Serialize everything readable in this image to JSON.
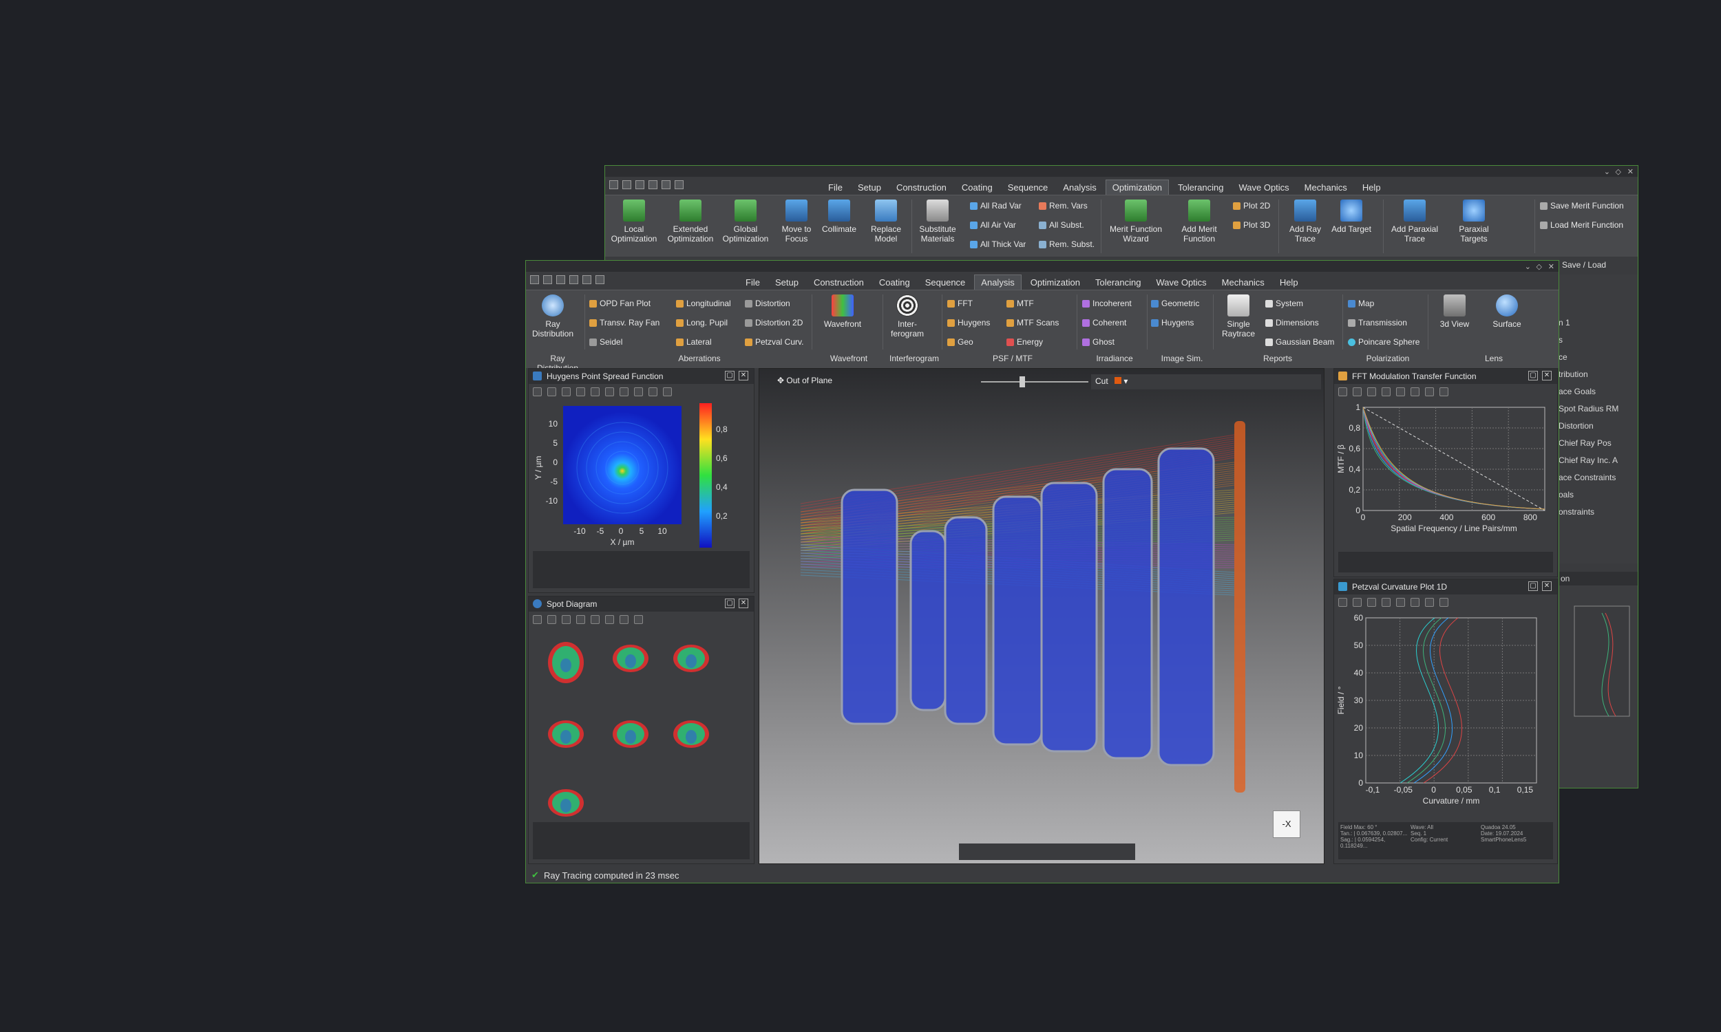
{
  "back_window": {
    "menu": [
      "File",
      "Setup",
      "Construction",
      "Coating",
      "Sequence",
      "Analysis",
      "Optimization",
      "Tolerancing",
      "Wave Optics",
      "Mechanics",
      "Help"
    ],
    "active_menu": "Optimization",
    "buttons": {
      "local_opt": "Local Optimization",
      "ext_opt": "Extended Optimization",
      "global_opt": "Global Optimization",
      "move_focus": "Move to Focus",
      "collimate": "Collimate",
      "replace": "Replace Model",
      "substitute": "Substitute Materials",
      "all_rad": "All Rad Var",
      "all_air": "All Air Var",
      "all_thick": "All Thick Var",
      "rem_vars": "Rem. Vars",
      "all_subst": "All Subst.",
      "rem_subst": "Rem. Subst.",
      "merit_wizard": "Merit Function Wizard",
      "add_merit": "Add Merit Function",
      "plot2d": "Plot 2D",
      "plot3d": "Plot 3D",
      "add_ray": "Add Ray Trace",
      "add_target": "Add Target",
      "add_paraxial": "Add Paraxial Trace",
      "paraxial_targets": "Paraxial Targets",
      "save_merit": "Save Merit Function",
      "load_merit": "Load Merit Function",
      "save_load": "Save / Load"
    },
    "side_list": [
      "n 1",
      "s",
      "ce",
      "tribution",
      "ace Goals",
      "Spot Radius RM",
      "Distortion",
      "Chief Ray Pos",
      "Chief Ray Inc. A",
      "ace Constraints",
      "oals",
      "onstraints"
    ],
    "side_panel2": "on"
  },
  "front_window": {
    "menu": [
      "File",
      "Setup",
      "Construction",
      "Coating",
      "Sequence",
      "Analysis",
      "Optimization",
      "Tolerancing",
      "Wave Optics",
      "Mechanics",
      "Help"
    ],
    "active_menu": "Analysis",
    "ribbon": {
      "ray_dist": "Ray Distribution",
      "opd_fan": "OPD Fan Plot",
      "transv_fan": "Transv. Ray Fan",
      "seidel": "Seidel",
      "longitudinal": "Longitudinal",
      "long_pupil": "Long. Pupil",
      "lateral": "Lateral",
      "distortion": "Distortion",
      "distortion2d": "Distortion 2D",
      "petzval": "Petzval Curv.",
      "wavefront": "Wavefront",
      "interferogram": "Inter-ferogram",
      "fft": "FFT",
      "huygens": "Huygens",
      "geo": "Geo",
      "mtf": "MTF",
      "mtf_scans": "MTF Scans",
      "energy": "Energy",
      "incoherent": "Incoherent",
      "coherent": "Coherent",
      "ghost": "Ghost",
      "geometric": "Geometric",
      "huygens2": "Huygens",
      "single_raytrace": "Single Raytrace",
      "system": "System",
      "dimensions": "Dimensions",
      "gaussian": "Gaussian Beam",
      "map": "Map",
      "transmission": "Transmission",
      "poincare": "Poincare Sphere",
      "view3d": "3d View",
      "surface": "Surface"
    },
    "groups": [
      "Ray Distribution",
      "Aberrations",
      "Wavefront",
      "Interferogram",
      "PSF / MTF",
      "Irradiance",
      "Image Sim.",
      "Reports",
      "Polarization",
      "Lens"
    ],
    "status": "Ray Tracing computed in 23 msec"
  },
  "psf_panel": {
    "title": "Huygens Point Spread Function",
    "xlabel": "X / µm",
    "ylabel": "Y / µm",
    "xticks": [
      "-10",
      "-5",
      "0",
      "5",
      "10"
    ],
    "yticks": [
      "10",
      "5",
      "0",
      "-5",
      "-10"
    ],
    "cbar_ticks": [
      "0,8",
      "0,6",
      "0,4",
      "0,2"
    ]
  },
  "spot_panel": {
    "title": "Spot Diagram"
  },
  "viewer": {
    "label": "Out of Plane",
    "cut": "Cut",
    "axis_btn": "-X"
  },
  "mtf_panel": {
    "title": "FFT Modulation Transfer Function",
    "xlabel": "Spatial Frequency / Line Pairs/mm",
    "ylabel": "MTF / β",
    "xticks": [
      "0",
      "200",
      "400",
      "600",
      "800"
    ],
    "yticks": [
      "1",
      "0,8",
      "0,6",
      "0,4",
      "0,2",
      "0"
    ]
  },
  "petzval_panel": {
    "title": "Petzval Curvature Plot 1D",
    "xlabel": "Curvature / mm",
    "ylabel": "Field / °",
    "xticks": [
      "-0,1",
      "-0,05",
      "0",
      "0,05",
      "0,1",
      "0,15"
    ],
    "yticks": [
      "60",
      "50",
      "40",
      "30",
      "20",
      "10",
      "0"
    ],
    "info": [
      "Field Max: 60 °",
      "Tan.: | 0.067639, 0.02807...",
      "Sag.: | 0.0594254, 0.118249...",
      "Wave: All",
      "Seq. 1",
      "Config: Current",
      "Quadoa 24.05",
      "Date: 19.07.2024",
      "SmartPhoneLens5"
    ]
  },
  "colors": {
    "accent": "#3a9a3a",
    "border_green": "#4a8a3a",
    "bg": "#1f2126"
  }
}
